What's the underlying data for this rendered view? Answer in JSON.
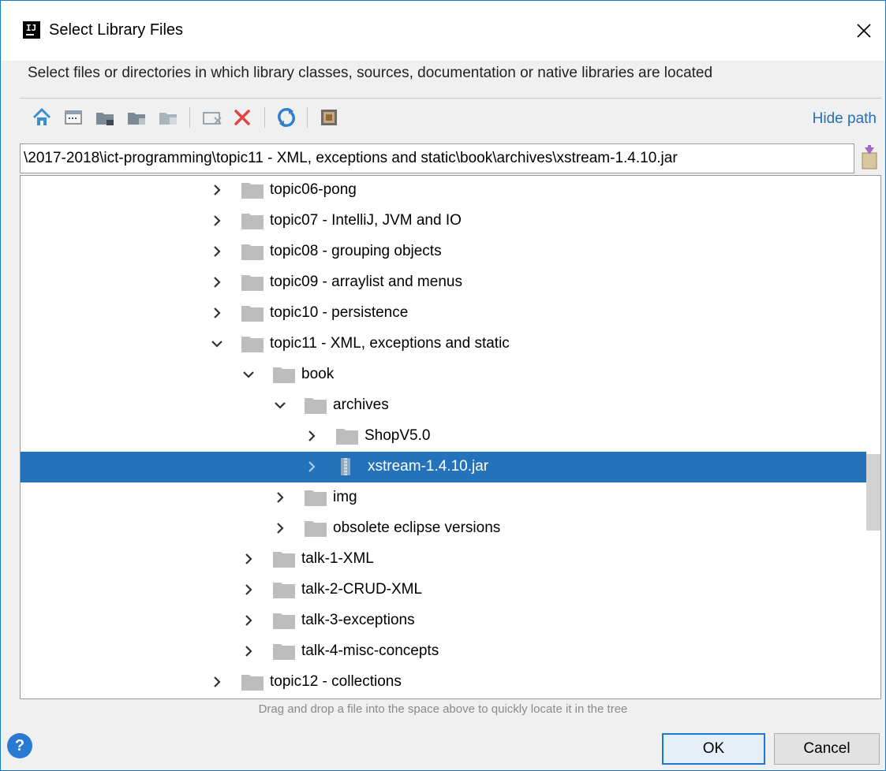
{
  "window": {
    "title": "Select Library Files",
    "description": "Select files or directories in which library classes, sources, documentation or native libraries are located"
  },
  "toolbar": {
    "icons": [
      "home-icon",
      "desktop-icon",
      "project-folder-icon",
      "module-folder-icon",
      "new-folder-icon",
      "delete-icon",
      "refresh-icon",
      "show-hidden-icon"
    ],
    "hide_path_label": "Hide path"
  },
  "path": {
    "value": "\\2017-2018\\ict-programming\\topic11 - XML, exceptions and static\\book\\archives\\xstream-1.4.10.jar"
  },
  "tree": {
    "rows": [
      {
        "label": "topic06-pong",
        "depth": 0,
        "expanded": false,
        "kind": "folder"
      },
      {
        "label": "topic07 - IntelliJ, JVM and IO",
        "depth": 0,
        "expanded": false,
        "kind": "folder"
      },
      {
        "label": "topic08 - grouping objects",
        "depth": 0,
        "expanded": false,
        "kind": "folder"
      },
      {
        "label": "topic09 - arraylist and menus",
        "depth": 0,
        "expanded": false,
        "kind": "folder"
      },
      {
        "label": "topic10 - persistence",
        "depth": 0,
        "expanded": false,
        "kind": "folder"
      },
      {
        "label": "topic11 - XML, exceptions and static",
        "depth": 0,
        "expanded": true,
        "kind": "folder"
      },
      {
        "label": "book",
        "depth": 1,
        "expanded": true,
        "kind": "folder"
      },
      {
        "label": "archives",
        "depth": 2,
        "expanded": true,
        "kind": "folder"
      },
      {
        "label": "ShopV5.0",
        "depth": 3,
        "expanded": false,
        "kind": "folder"
      },
      {
        "label": "xstream-1.4.10.jar",
        "depth": 3,
        "expanded": false,
        "kind": "jar",
        "selected": true
      },
      {
        "label": "img",
        "depth": 2,
        "expanded": false,
        "kind": "folder"
      },
      {
        "label": "obsolete eclipse versions",
        "depth": 2,
        "expanded": false,
        "kind": "folder"
      },
      {
        "label": "talk-1-XML",
        "depth": 1,
        "expanded": false,
        "kind": "folder"
      },
      {
        "label": "talk-2-CRUD-XML",
        "depth": 1,
        "expanded": false,
        "kind": "folder"
      },
      {
        "label": "talk-3-exceptions",
        "depth": 1,
        "expanded": false,
        "kind": "folder"
      },
      {
        "label": "talk-4-misc-concepts",
        "depth": 1,
        "expanded": false,
        "kind": "folder"
      },
      {
        "label": "topic12 - collections",
        "depth": 0,
        "expanded": false,
        "kind": "folder"
      }
    ]
  },
  "hint": "Drag and drop a file into the space above to quickly locate it in the tree",
  "buttons": {
    "help": "?",
    "ok": "OK",
    "cancel": "Cancel"
  },
  "colors": {
    "selection": "#2472b9",
    "accent": "#1979c5",
    "link": "#2470b3",
    "folder": "#bdbdbd"
  }
}
